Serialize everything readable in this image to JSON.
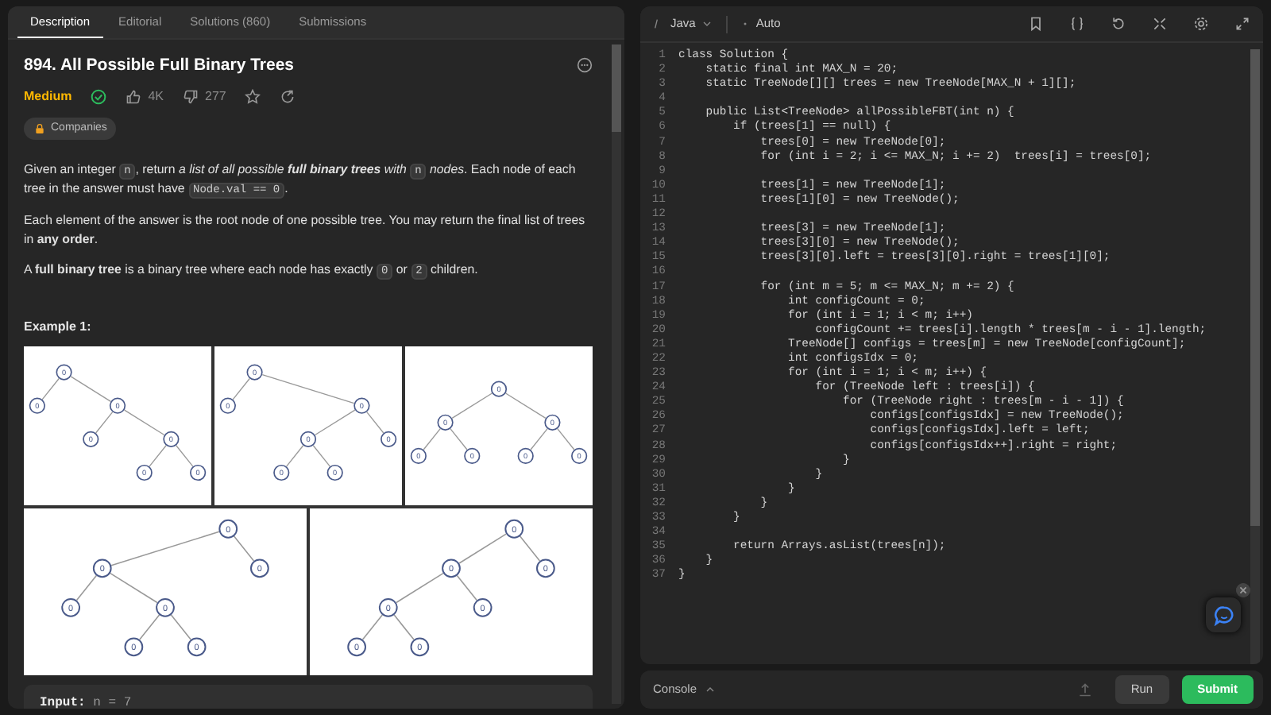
{
  "tabs": [
    {
      "label": "Description",
      "selected": true
    },
    {
      "label": "Editorial",
      "selected": false
    },
    {
      "label": "Solutions (860)",
      "selected": false
    },
    {
      "label": "Submissions",
      "selected": false
    }
  ],
  "problem": {
    "title": "894. All Possible Full Binary Trees",
    "difficulty": "Medium",
    "solved": true,
    "likes": "4K",
    "dislikes": "277",
    "companies": "Companies",
    "paragraphs": [
      [
        {
          "kind": "text",
          "text": "Given an integer "
        },
        {
          "kind": "code",
          "text": "n"
        },
        {
          "kind": "text",
          "text": ", return *a list of all possible* "
        },
        {
          "kind": "text",
          "italic": true,
          "text": "**full binary trees** with "
        },
        {
          "kind": "code",
          "text": "n"
        },
        {
          "kind": "text",
          "text": " *nodes*. Each node of each tree in the answer must have "
        },
        {
          "kind": "code",
          "text": "Node.val == 0"
        },
        {
          "kind": "text",
          "text": "."
        }
      ],
      [
        {
          "kind": "text",
          "text": "Each element of the answer is the root node of one possible tree. You may return the final list of trees in **any order**."
        }
      ],
      [
        {
          "kind": "text",
          "text": "A **full binary tree** is a binary tree where each node has exactly "
        },
        {
          "kind": "code",
          "text": "0"
        },
        {
          "kind": "text",
          "text": " or "
        },
        {
          "kind": "code",
          "text": "2"
        },
        {
          "kind": "text",
          "text": " children."
        }
      ]
    ],
    "example": {
      "heading": "Example 1:",
      "trees": [
        {
          "value": "0",
          "children": [
            {
              "value": "0"
            },
            {
              "value": "0",
              "children": [
                {
                  "value": "0"
                },
                {
                  "value": "0",
                  "children": [
                    {
                      "value": "0"
                    },
                    {
                      "value": "0"
                    }
                  ]
                }
              ]
            }
          ]
        },
        {
          "value": "0",
          "children": [
            {
              "value": "0"
            },
            {
              "value": "0",
              "children": [
                {
                  "value": "0",
                  "children": [
                    {
                      "value": "0"
                    },
                    {
                      "value": "0"
                    }
                  ]
                },
                {
                  "value": "0"
                }
              ]
            }
          ]
        },
        {
          "value": "0",
          "children": [
            {
              "value": "0",
              "children": [
                {
                  "value": "0"
                },
                {
                  "value": "0"
                }
              ]
            },
            {
              "value": "0",
              "children": [
                {
                  "value": "0"
                },
                {
                  "value": "0"
                }
              ]
            }
          ]
        },
        {
          "value": "0",
          "children": [
            {
              "value": "0",
              "children": [
                {
                  "value": "0"
                },
                {
                  "value": "0",
                  "children": [
                    {
                      "value": "0"
                    },
                    {
                      "value": "0"
                    }
                  ]
                }
              ]
            },
            {
              "value": "0"
            }
          ]
        },
        {
          "value": "0",
          "children": [
            {
              "value": "0",
              "children": [
                {
                  "value": "0",
                  "children": [
                    {
                      "value": "0"
                    },
                    {
                      "value": "0"
                    }
                  ]
                },
                {
                  "value": "0"
                }
              ]
            },
            {
              "value": "0"
            }
          ]
        }
      ],
      "input_label": "Input:",
      "input_value": "n = 7"
    }
  },
  "editor": {
    "language": "Java",
    "mode": "Auto",
    "lines": [
      {
        "n": "1",
        "code": "class Solution {"
      },
      {
        "n": "2",
        "code": "    static final int MAX_N = 20;"
      },
      {
        "n": "3",
        "code": "    static TreeNode[][] trees = new TreeNode[MAX_N + 1][];"
      },
      {
        "n": "4"
      },
      {
        "n": "5",
        "code": "    public List<TreeNode> allPossibleFBT(int n) {"
      },
      {
        "n": "6",
        "code": "        if (trees[1] == null) {"
      },
      {
        "n": "7",
        "code": "            trees[0] = new TreeNode[0];"
      },
      {
        "n": "8",
        "code": "            for (int i = 2; i <= MAX_N; i += 2)  trees[i] = trees[0];"
      },
      {
        "n": "9"
      },
      {
        "n": "10",
        "code": "            trees[1] = new TreeNode[1];"
      },
      {
        "n": "11",
        "code": "            trees[1][0] = new TreeNode();"
      },
      {
        "n": "12"
      },
      {
        "n": "13",
        "code": "            trees[3] = new TreeNode[1];"
      },
      {
        "n": "14",
        "code": "            trees[3][0] = new TreeNode();"
      },
      {
        "n": "15",
        "code": "            trees[3][0].left = trees[3][0].right = trees[1][0];"
      },
      {
        "n": "16"
      },
      {
        "n": "17",
        "code": "            for (int m = 5; m <= MAX_N; m += 2) {"
      },
      {
        "n": "18",
        "code": "                int configCount = 0;"
      },
      {
        "n": "19",
        "code": "                for (int i = 1; i < m; i++)"
      },
      {
        "n": "20",
        "code": "                    configCount += trees[i].length * trees[m - i - 1].length;"
      },
      {
        "n": "21",
        "code": "                TreeNode[] configs = trees[m] = new TreeNode[configCount];"
      },
      {
        "n": "22",
        "code": "                int configsIdx = 0;"
      },
      {
        "n": "23",
        "code": "                for (int i = 1; i < m; i++) {"
      },
      {
        "n": "24",
        "code": "                    for (TreeNode left : trees[i]) {"
      },
      {
        "n": "25",
        "code": "                        for (TreeNode right : trees[m - i - 1]) {"
      },
      {
        "n": "26",
        "code": "                            configs[configsIdx] = new TreeNode();"
      },
      {
        "n": "27",
        "code": "                            configs[configsIdx].left = left;"
      },
      {
        "n": "28",
        "code": "                            configs[configsIdx++].right = right;"
      },
      {
        "n": "29",
        "code": "                        }"
      },
      {
        "n": "30",
        "code": "                    }"
      },
      {
        "n": "31",
        "code": "                }"
      },
      {
        "n": "32",
        "code": "            }"
      },
      {
        "n": "33",
        "code": "        }"
      },
      {
        "n": "34"
      },
      {
        "n": "35",
        "code": "        return Arrays.asList(trees[n]);"
      },
      {
        "n": "36",
        "code": "    }"
      },
      {
        "n": "37",
        "code": "}"
      }
    ]
  },
  "footer": {
    "console": "Console",
    "run": "Run",
    "submit": "Submit"
  }
}
